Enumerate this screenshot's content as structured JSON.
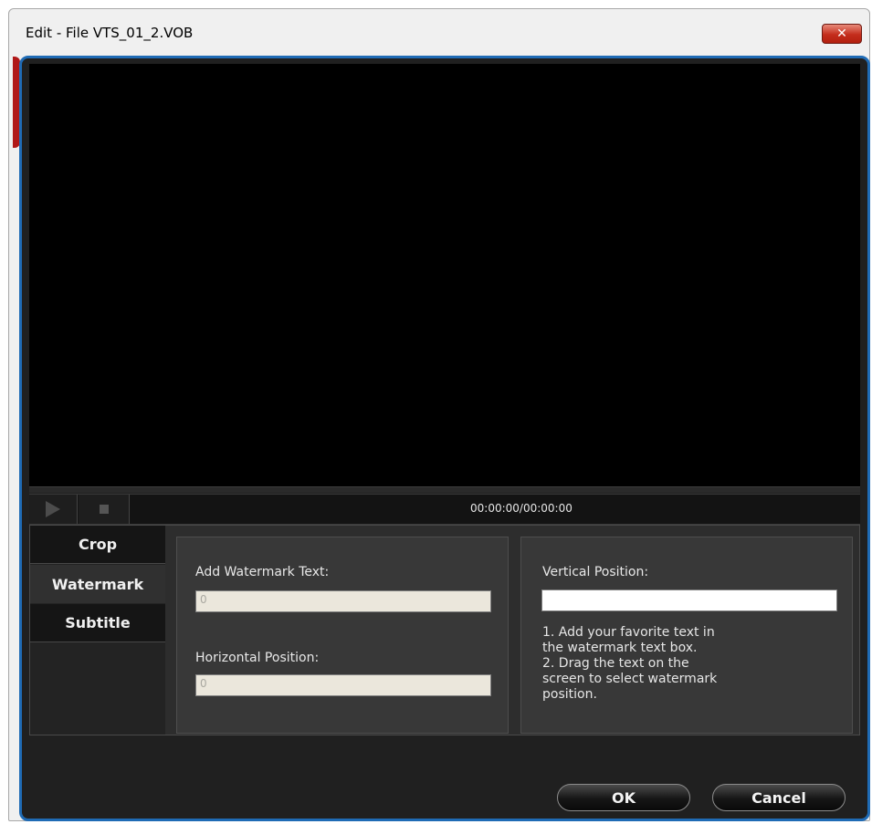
{
  "window": {
    "title": "Edit - File VTS_01_2.VOB",
    "close_glyph": "✕"
  },
  "player": {
    "time": "00:00:00/00:00:00",
    "play_icon": "play-icon",
    "stop_icon": "stop-icon"
  },
  "tabs": [
    {
      "label": "Crop"
    },
    {
      "label": "Watermark"
    },
    {
      "label": "Subtitle"
    }
  ],
  "watermark": {
    "text_label": "Add Watermark Text:",
    "text_value": "0",
    "horizontal_label": "Horizontal Position:",
    "horizontal_value": "0",
    "vertical_label": "Vertical Position:",
    "vertical_value": "",
    "hint_lines": [
      "1. Add your favorite text in",
      "the watermark text box.",
      "2. Drag the text on the",
      "screen to select watermark",
      "position."
    ]
  },
  "buttons": {
    "ok": "OK",
    "cancel": "Cancel"
  },
  "colors": {
    "panel_border": "#1f6bb5",
    "close_button": "#c42d1c",
    "accent": "#b01818"
  }
}
